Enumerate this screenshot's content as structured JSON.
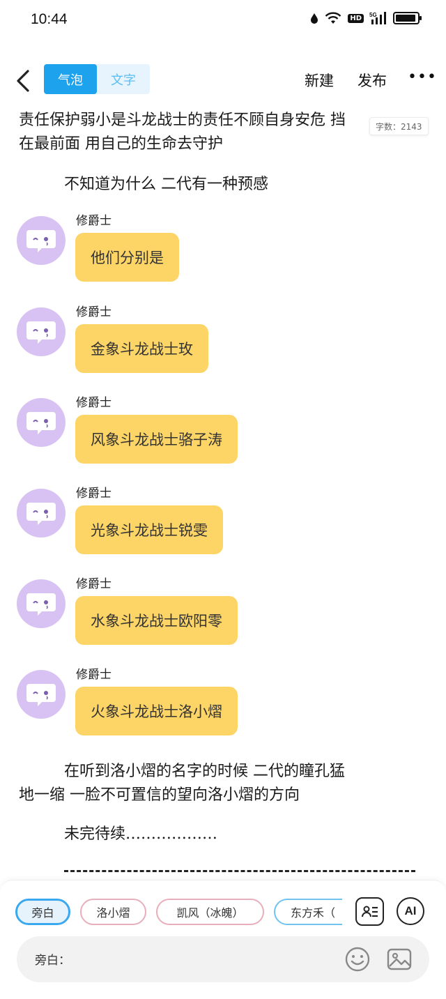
{
  "status_bar": {
    "time": "10:44",
    "hd_label": "HD",
    "signal_label": "5G"
  },
  "header": {
    "mode_bubble": "气泡",
    "mode_text": "文字",
    "new_label": "新建",
    "publish_label": "发布",
    "more_label": "•••"
  },
  "word_count": "字数：2143",
  "story": {
    "para1_line1": "责任保护弱小是斗龙战士的责任不顾自身安危 挡",
    "para1_line2": "在最前面 用自己的生命去守护",
    "para2": "不知道为什么 二代有一种预感",
    "messages": [
      {
        "name": "修爵士",
        "text": "他们分别是"
      },
      {
        "name": "修爵士",
        "text": "金象斗龙战士玫"
      },
      {
        "name": "修爵士",
        "text": "风象斗龙战士骆子涛"
      },
      {
        "name": "修爵士",
        "text": "光象斗龙战士锐雯"
      },
      {
        "name": "修爵士",
        "text": "水象斗龙战士欧阳零"
      },
      {
        "name": "修爵士",
        "text": "火象斗龙战士洛小熠"
      }
    ],
    "para3_line1": "在听到洛小熠的名字的时候 二代的瞳孔猛",
    "para3_line2": "地一缩 一脸不可置信的望向洛小熠的方向",
    "para4": "未完待续………………"
  },
  "roles": {
    "chips": [
      "旁白",
      "洛小熠",
      "凯风（冰魄）",
      "东方禾（"
    ],
    "ai_label": "AI"
  },
  "input": {
    "label": "旁白：",
    "value": ""
  },
  "colors": {
    "accent_blue": "#1da3ee",
    "bubble_yellow": "#fdd466",
    "avatar_purple": "#d8c2f3",
    "chip_pink": "#e8aebb"
  }
}
